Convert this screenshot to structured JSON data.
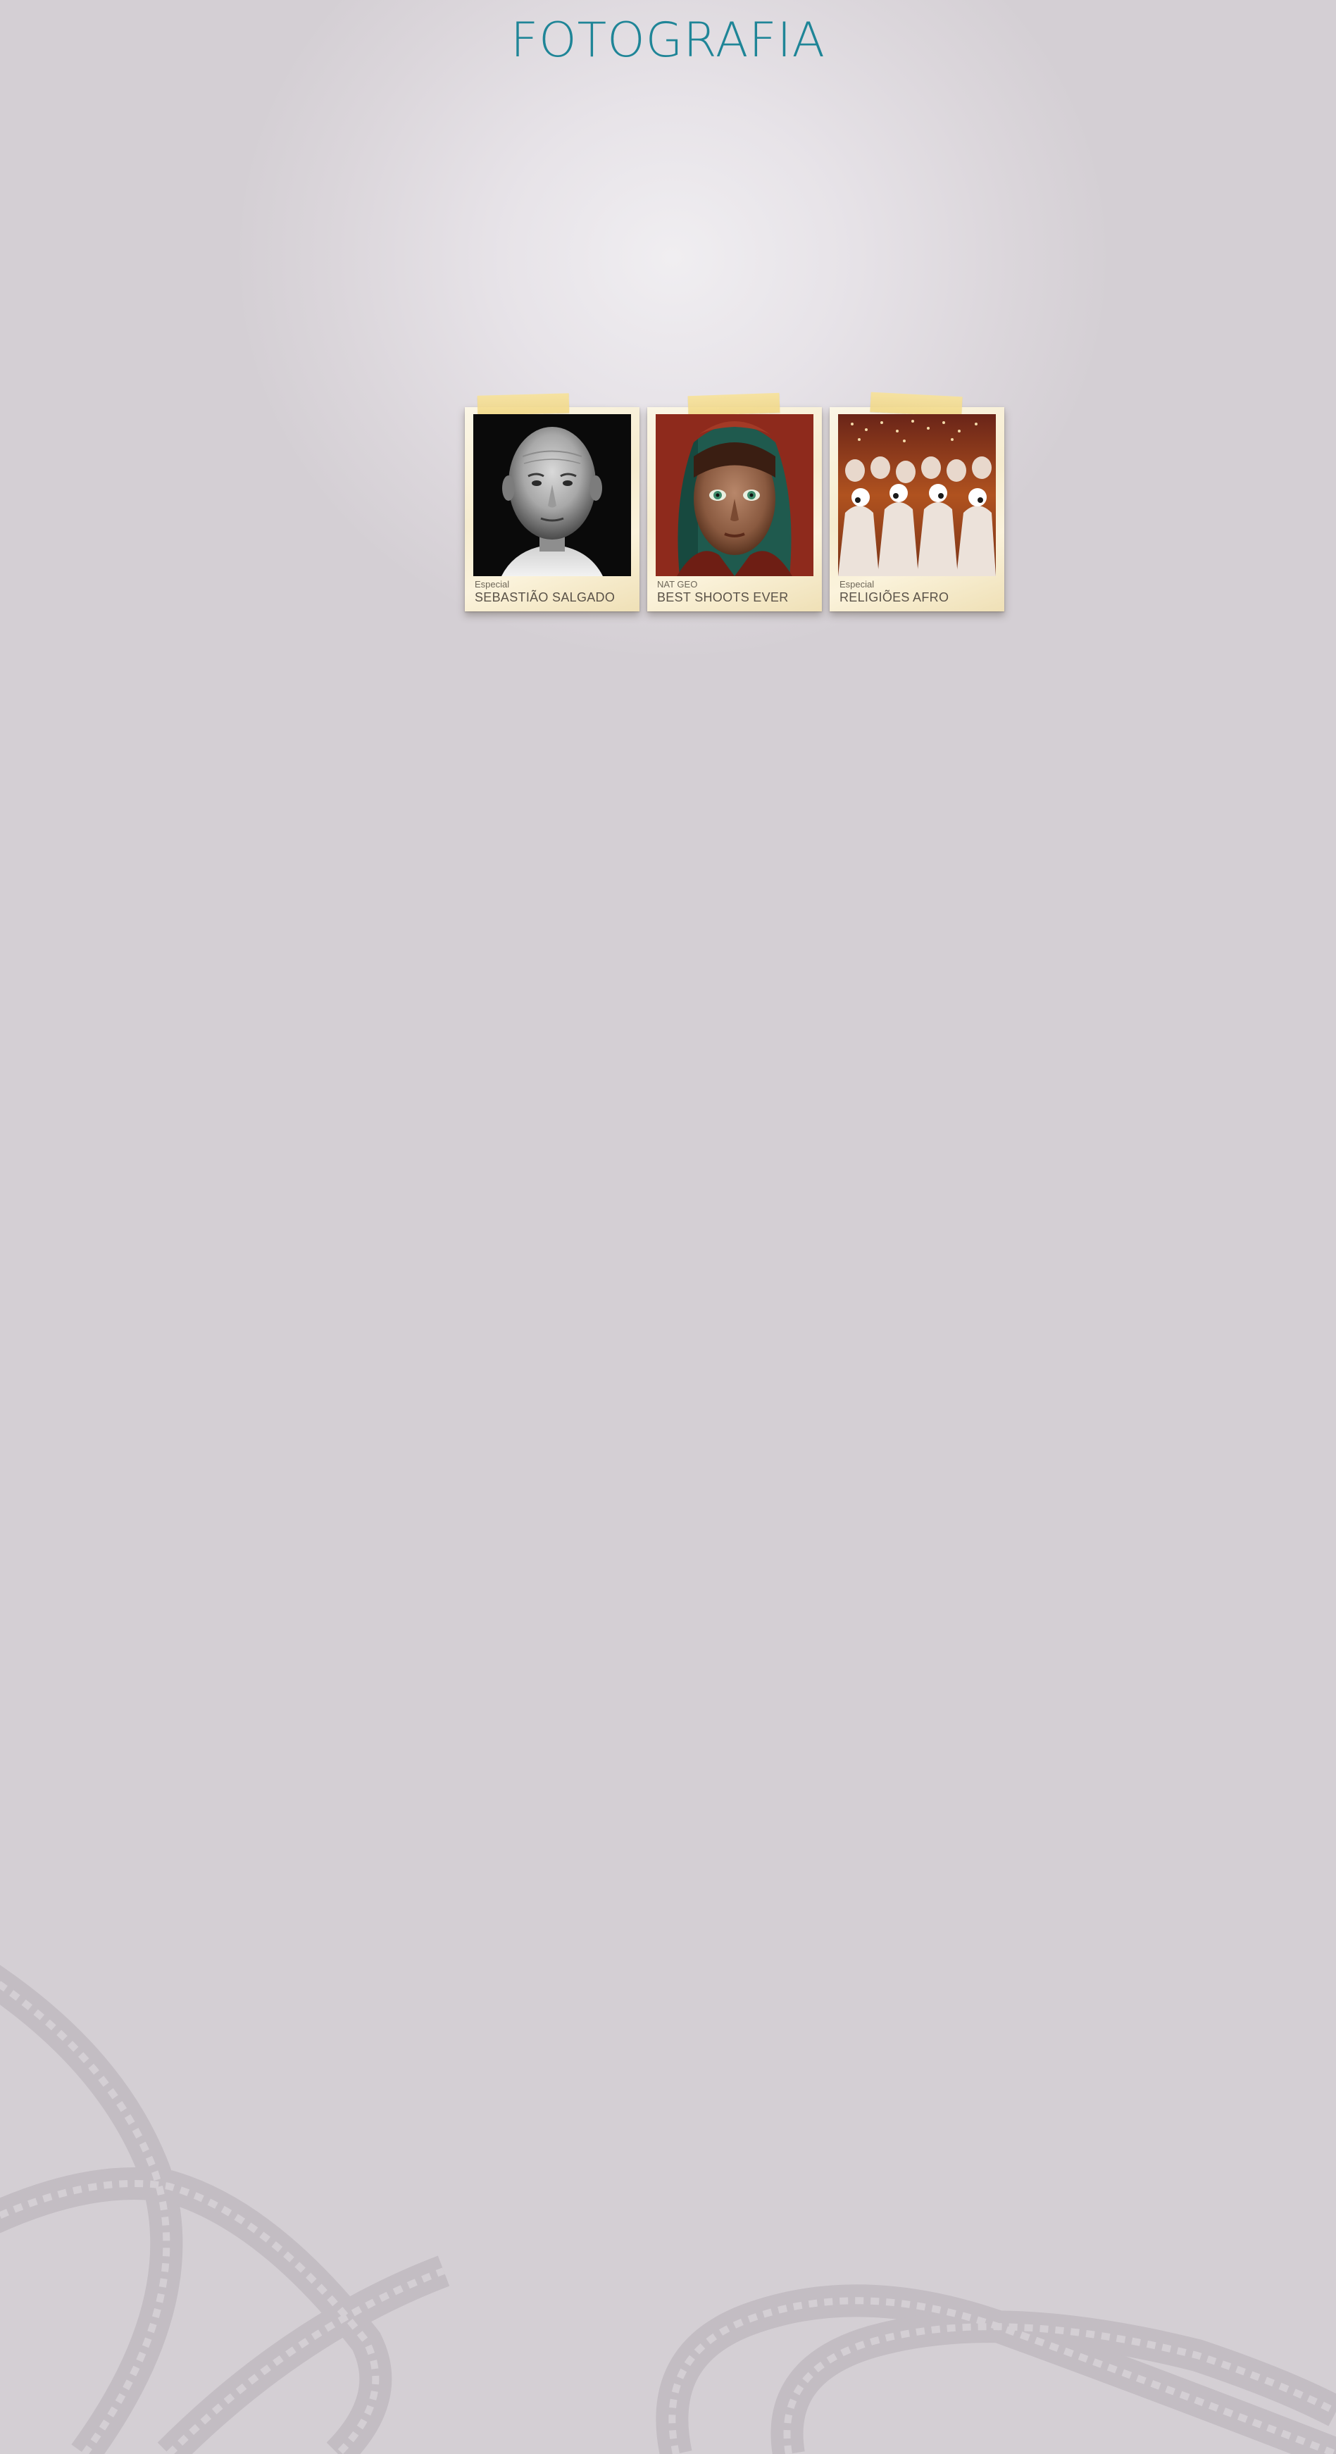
{
  "page": {
    "title": "FOTOGRAFIA"
  },
  "gallery": {
    "cards": [
      {
        "category": "Especial",
        "title": "SEBASTIÃO SALGADO",
        "photo": "portrait-bald-man-bw"
      },
      {
        "category": "NAT GEO",
        "title": "BEST SHOOTS EVER",
        "photo": "portrait-green-eyed-girl"
      },
      {
        "category": "Especial",
        "title": "RELIGIÕES AFRO",
        "photo": "ceremony-white-dressed-people"
      }
    ]
  },
  "colors": {
    "background": "#d4cfd4",
    "title": "#1f8597",
    "card_paper": "#f6eccf",
    "tape": "#f2d98c",
    "film_decor": "#c2bcc2"
  },
  "icons": [
    "film-strip-icon"
  ]
}
